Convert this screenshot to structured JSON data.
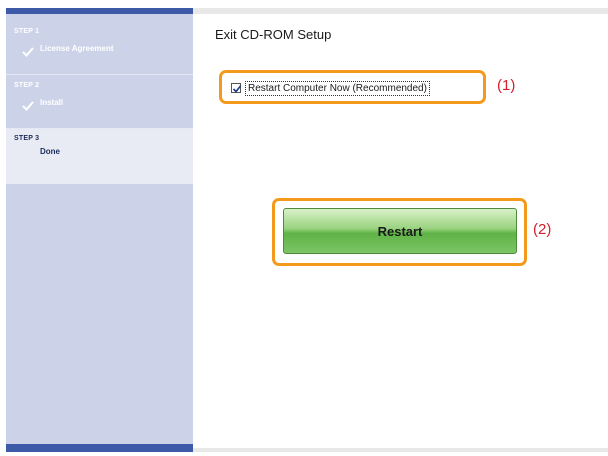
{
  "sidebar": {
    "steps": [
      {
        "number": "STEP 1",
        "label": "License Agreement",
        "completed": true
      },
      {
        "number": "STEP 2",
        "label": "Install",
        "completed": true
      },
      {
        "number": "STEP 3",
        "label": "Done",
        "completed": false,
        "active": true
      }
    ]
  },
  "main": {
    "title": "Exit CD-ROM Setup",
    "checkbox": {
      "label": "Restart Computer Now (Recommended)",
      "checked": true
    },
    "restart_button": "Restart"
  },
  "callouts": {
    "one": "(1)",
    "two": "(2)"
  },
  "colors": {
    "sidebar_bg": "#ccd3e8",
    "sidebar_accent": "#3c5aa8",
    "highlight": "#f39a1c",
    "callout": "#d4202a",
    "button_green": "#5fb346"
  }
}
